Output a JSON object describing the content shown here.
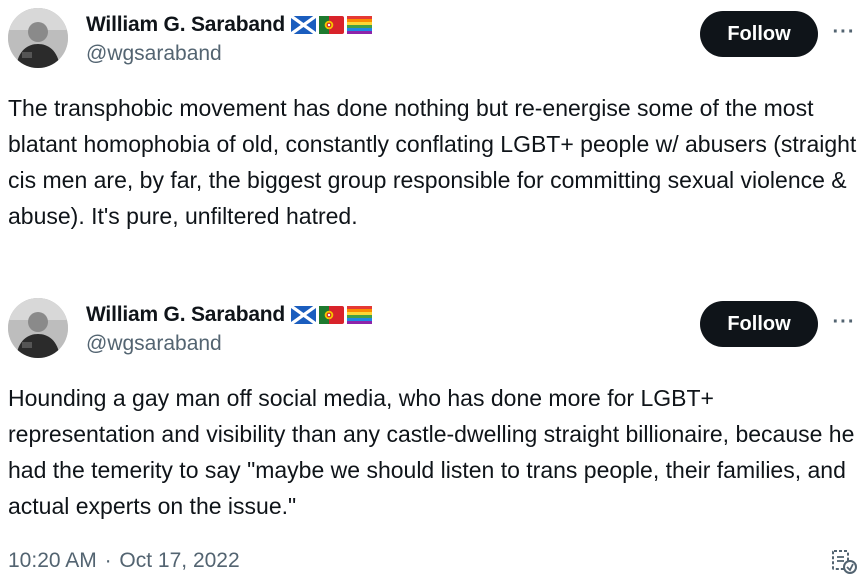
{
  "tweets": [
    {
      "display_name": "William G. Saraband",
      "flag_icons": [
        "scotland-flag-icon",
        "portugal-flag-icon",
        "rainbow-flag-icon"
      ],
      "handle": "@wgsaraband",
      "follow_label": "Follow",
      "more_label": "···",
      "text": "The transphobic movement has done nothing but re-energise some of the most blatant homophobia of old, constantly conflating LGBT+ people w/ abusers (straight cis men are, by far, the biggest group responsible for committing sexual violence & abuse). It's pure, unfiltered hatred."
    },
    {
      "display_name": "William G. Saraband",
      "flag_icons": [
        "scotland-flag-icon",
        "portugal-flag-icon",
        "rainbow-flag-icon"
      ],
      "handle": "@wgsaraband",
      "follow_label": "Follow",
      "more_label": "···",
      "text": "Hounding a gay man off social media, who has done more for LGBT+ representation and visibility than any castle-dwelling straight billionaire, because he had the temerity to say \"maybe we should listen to trans people, their families, and actual experts on the issue.\""
    }
  ],
  "footer": {
    "time": "10:20 AM",
    "separator": "·",
    "date": "Oct 17, 2022",
    "icon": "translate-icon"
  },
  "colors": {
    "text_primary": "#0f1419",
    "text_secondary": "#536471",
    "follow_button_bg": "#0f1419",
    "follow_button_text": "#ffffff"
  }
}
